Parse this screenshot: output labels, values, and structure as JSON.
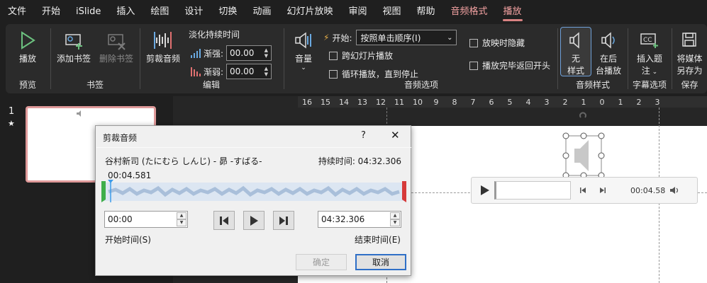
{
  "menu": {
    "items": [
      "文件",
      "开始",
      "iSlide",
      "插入",
      "绘图",
      "设计",
      "切换",
      "动画",
      "幻灯片放映",
      "审阅",
      "视图",
      "帮助"
    ],
    "context_tab": "音频格式",
    "active_tab": "播放"
  },
  "ribbon": {
    "preview": {
      "play_label": "播放",
      "group_label": "预览"
    },
    "bookmarks": {
      "add_label": "添加书签",
      "remove_label": "删除书签",
      "group_label": "书签"
    },
    "editing": {
      "trim_label": "剪裁音频",
      "fade_title": "淡化持续时间",
      "fade_in_label": "渐强:",
      "fade_in_value": "00.00",
      "fade_out_label": "渐弱:",
      "fade_out_value": "00.00",
      "group_label": "编辑"
    },
    "audio_options": {
      "volume_label": "音量",
      "start_label": "开始:",
      "start_value": "按照单击顺序(I)",
      "across_slides_label": "跨幻灯片播放",
      "loop_label": "循环播放，直到停止",
      "hide_label": "放映时隐藏",
      "rewind_label": "播放完毕返回开头",
      "group_label": "音频选项"
    },
    "audio_styles": {
      "no_style_line1": "无",
      "no_style_line2": "样式",
      "background_line1": "在后",
      "background_line2": "台播放",
      "group_label": "音频样式"
    },
    "captions": {
      "insert_line1": "插入题",
      "insert_line2": "注",
      "group_label": "字幕选项"
    },
    "save": {
      "save_line1": "将媒体",
      "save_line2": "另存为",
      "group_label": "保存"
    }
  },
  "ruler": {
    "ticks": [
      "16",
      "15",
      "14",
      "13",
      "12",
      "11",
      "10",
      "9",
      "8",
      "7",
      "6",
      "5",
      "4",
      "3",
      "2",
      "1",
      "0",
      "1",
      "2",
      "3"
    ]
  },
  "slides": {
    "number": "1",
    "marker": "★"
  },
  "player": {
    "time": "00:04.58"
  },
  "dialog": {
    "title": "剪裁音频",
    "help": "?",
    "close": "✕",
    "song": "谷村新司 (たにむら しんじ) - 昴 -すばる-",
    "duration": "持续时间: 04:32.306",
    "current": "00:04.581",
    "start_time_value": "00:00",
    "start_time_label": "开始时间(S)",
    "end_time_value": "04:32.306",
    "end_time_label": "结束时间(E)",
    "ok_label": "确定",
    "cancel_label": "取消"
  },
  "colors": {
    "accent_pink": "#f2a1a1",
    "ribbon_bg": "#2b2b2b",
    "menubar_bg": "#1f1f1f"
  }
}
